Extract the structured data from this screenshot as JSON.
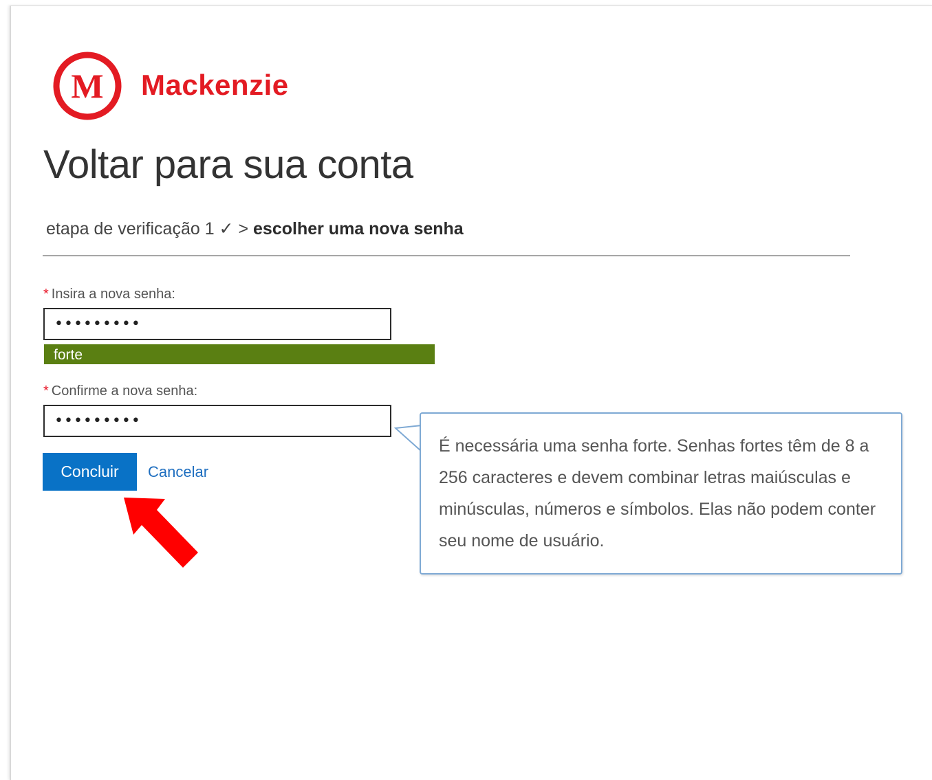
{
  "brand": {
    "name": "Mackenzie",
    "logo_letter": "M",
    "color": "#e31b23"
  },
  "page": {
    "title": "Voltar para sua conta"
  },
  "steps": {
    "completed": "etapa de verificação 1 ✓",
    "separator": ">",
    "current": "escolher uma nova senha"
  },
  "form": {
    "required_mark": "*",
    "new_password": {
      "label": "Insira a nova senha:",
      "value": "•••••••••"
    },
    "strength": {
      "label": "forte",
      "color": "#5a7f12"
    },
    "confirm_password": {
      "label": "Confirme a nova senha:",
      "value": "•••••••••"
    },
    "submit_label": "Concluir",
    "cancel_label": "Cancelar"
  },
  "tooltip": {
    "text": "É necessária uma senha forte. Senhas fortes têm de 8 a 256 caracteres e devem combinar letras maiúsculas e minúsculas, números e símbolos. Elas não podem conter seu nome de usuário."
  },
  "annotation": {
    "icon": "red-arrow-icon",
    "color": "#ff0000"
  },
  "colors": {
    "primary_button": "#0972c6",
    "link": "#1f6fc0",
    "tooltip_border": "#7ea9d4"
  }
}
